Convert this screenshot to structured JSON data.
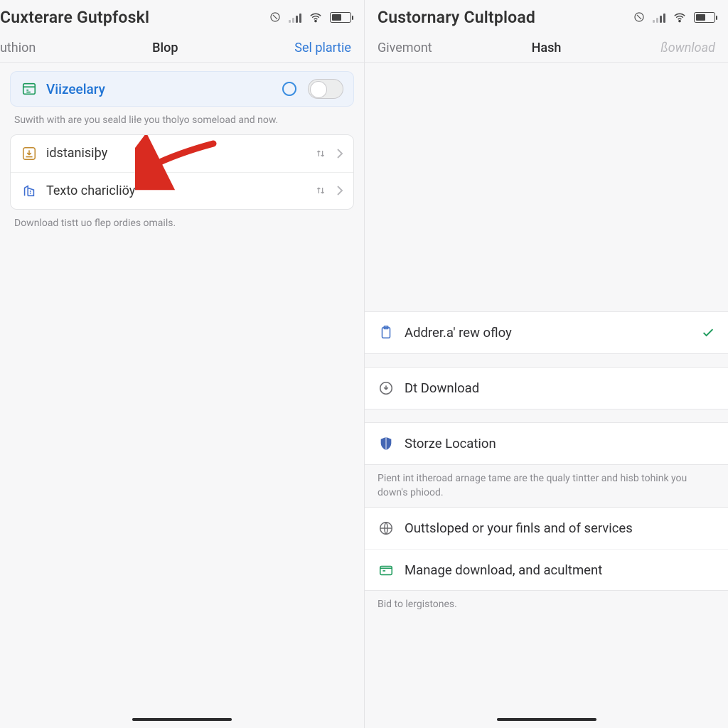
{
  "left": {
    "title": "Cuxterare Gutpfoskl",
    "tabs": {
      "a": "uthion",
      "b": "Blop",
      "c": "Sel plartie"
    },
    "hero": {
      "label": "Viizeelary"
    },
    "hero_caption": "Suwith with are you seald liłe you tholyo someload and now.",
    "rows": [
      {
        "label": "idstanisiþy"
      },
      {
        "label": "Texto charicliöy"
      }
    ],
    "footer": "Download tistt uo flep ordies omails."
  },
  "right": {
    "title": "Custornary Cultpload",
    "tabs": {
      "a": "Givemont",
      "b": "Hash",
      "c": "ßownload"
    },
    "rows1": [
      {
        "label": "Addrer.a' rew ofloy",
        "check": true
      },
      {
        "label": "Dt Download"
      },
      {
        "label": "Storze Location"
      }
    ],
    "note1": "Pient int itheroad arnage tame are the qualy tintter and hisb tohink you down's phiood.",
    "rows2": [
      {
        "label": "Outtsloped or your finls and of services"
      },
      {
        "label": "Manage download, and acultment"
      }
    ],
    "note2": "Bid to lergistones."
  }
}
